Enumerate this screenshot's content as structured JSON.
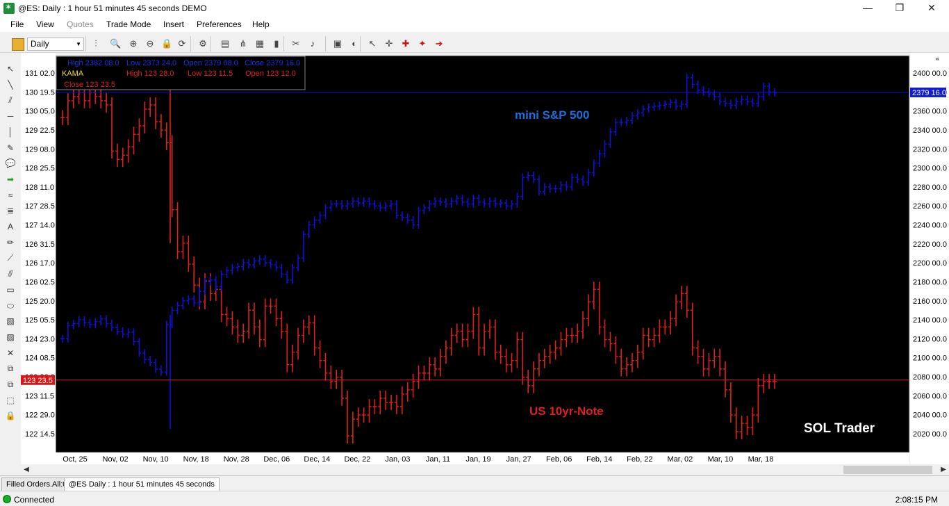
{
  "window": {
    "title": "@ES: Daily : 1 hour 51 minutes 45 seconds DEMO",
    "minimize": "—",
    "restore": "❐",
    "close": "✕"
  },
  "menu": [
    "File",
    "View",
    "Quotes",
    "Trade Mode",
    "Insert",
    "Preferences",
    "Help"
  ],
  "toolbar": {
    "timeframe": "Daily",
    "icons": [
      "bar-style-icon",
      "zoom-icon",
      "zoom-in-icon",
      "zoom-out-icon",
      "lock-icon",
      "refresh-icon",
      "chart-settings-icon",
      "template-icon",
      "hierarchy-icon",
      "indicator-icon",
      "strategy-icon",
      "scissors-icon",
      "alert-bell-icon",
      "paint-icon",
      "eraser-icon",
      "cursor-icon",
      "crosshair-icon",
      "crosshair-red-icon",
      "target-icon",
      "arrow-target-icon"
    ]
  },
  "left_tools": [
    "cursor-icon",
    "line-icon",
    "parallel-lines-icon",
    "horizontal-line-icon",
    "vertical-line-icon",
    "note-icon",
    "callout-icon",
    "arrow-icon",
    "wave-icon",
    "fib-icon",
    "text-tool-icon",
    "pencil-icon",
    "trend-icon",
    "channel-icon",
    "rectangle-icon",
    "ellipse-icon",
    "gallery-icon",
    "image-icon",
    "delete-icon",
    "copy-icon",
    "paste-icon",
    "select-area-icon",
    "lock-icon"
  ],
  "chart_data": {
    "type": "bar",
    "overlay": {
      "line1": {
        "high_label": "High",
        "high": "2382 08.0",
        "low_label": "Low",
        "low": "2373 24.0",
        "open_label": "Open",
        "open": "2379 08.0",
        "close_label": "Close",
        "close": "2379 16.0"
      },
      "line2": {
        "name": "KAMA",
        "high_label": "High",
        "high": "123 28.0",
        "low_label": "Low",
        "low": "123 11.5",
        "open_label": "Open",
        "open": "123 12.0"
      },
      "line3": {
        "close_label": "Close",
        "close": "123 23.5"
      }
    },
    "annotations": {
      "sp_label": "mini S&P 500",
      "note_label": "US 10yr-Note",
      "brand": "SOL Trader"
    },
    "colors": {
      "sp": "#1010d8",
      "note": "#e02020",
      "background": "#000000",
      "frame": "#c8c8c8",
      "sp_marker": "#1020d0",
      "note_marker": "#d81818"
    },
    "x_labels": [
      "Oct, 25",
      "Nov, 02",
      "Nov, 10",
      "Nov, 18",
      "Nov, 28",
      "Dec, 06",
      "Dec, 14",
      "Dec, 22",
      "Jan, 03",
      "Jan, 11",
      "Jan, 19",
      "Jan, 27",
      "Feb, 06",
      "Feb, 14",
      "Feb, 22",
      "Mar, 02",
      "Mar, 10",
      "Mar, 18"
    ],
    "left_axis": {
      "ticks": [
        "131 02.0",
        "130 19.5",
        "130 05.0",
        "129 22.5",
        "129 08.0",
        "128 25.5",
        "128 11.0",
        "127 28.5",
        "127 14.0",
        "126 31.5",
        "126 17.0",
        "126 02.5",
        "125 20.0",
        "125 05.5",
        "124 23.0",
        "124 08.5",
        "123 26.0",
        "123 11.5",
        "122 29.0",
        "122 14.5"
      ],
      "current": "123 23.5",
      "current_value": 123.734
    },
    "right_axis": {
      "ticks": [
        "2400 00.0",
        "2380 00.0",
        "2360 00.0",
        "2340 00.0",
        "2320 00.0",
        "2300 00.0",
        "2280 00.0",
        "2260 00.0",
        "2240 00.0",
        "2220 00.0",
        "2200 00.0",
        "2180 00.0",
        "2160 00.0",
        "2140 00.0",
        "2120 00.0",
        "2100 00.0",
        "2080 00.0",
        "2060 00.0",
        "2040 00.0",
        "2020 00.0"
      ],
      "current": "2379 16.0",
      "current_value": 2379.5,
      "ylim": [
        2020,
        2400
      ]
    },
    "sp_series": {
      "name": "mini S&P 500",
      "closes": [
        2120,
        2134,
        2136,
        2140,
        2137,
        2135,
        2138,
        2141,
        2136,
        2132,
        2128,
        2125,
        2127,
        2117,
        2105,
        2098,
        2095,
        2088,
        2085,
        2135,
        2150,
        2155,
        2160,
        2162,
        2158,
        2170,
        2180,
        2182,
        2175,
        2188,
        2192,
        2195,
        2196,
        2200,
        2198,
        2202,
        2204,
        2200,
        2198,
        2195,
        2188,
        2182,
        2195,
        2205,
        2230,
        2240,
        2245,
        2250,
        2258,
        2262,
        2262,
        2260,
        2262,
        2265,
        2263,
        2265,
        2262,
        2260,
        2258,
        2260,
        2262,
        2250,
        2248,
        2245,
        2240,
        2255,
        2258,
        2262,
        2265,
        2264,
        2262,
        2265,
        2268,
        2264,
        2262,
        2268,
        2264,
        2262,
        2265,
        2262,
        2263,
        2260,
        2262,
        2270,
        2290,
        2292,
        2288,
        2275,
        2280,
        2278,
        2278,
        2282,
        2280,
        2290,
        2288,
        2285,
        2295,
        2305,
        2315,
        2325,
        2338,
        2348,
        2348,
        2350,
        2355,
        2358,
        2362,
        2364,
        2365,
        2366,
        2367,
        2369,
        2365,
        2367,
        2395,
        2388,
        2382,
        2380,
        2378,
        2375,
        2370,
        2368,
        2366,
        2370,
        2372,
        2370,
        2368,
        2375,
        2386,
        2380,
        2379
      ]
    },
    "note_series": {
      "name": "US 10yr-Note",
      "closes": [
        130.0,
        130.4,
        130.5,
        130.6,
        130.4,
        130.6,
        130.5,
        130.4,
        130.3,
        129.2,
        129.0,
        129.1,
        129.3,
        129.6,
        129.8,
        130.2,
        130.3,
        129.9,
        129.7,
        129.4,
        127.8,
        126.8,
        127.0,
        126.5,
        126.0,
        125.6,
        126.1,
        125.8,
        125.9,
        125.3,
        125.2,
        125.0,
        124.8,
        124.9,
        125.4,
        125.0,
        124.7,
        125.5,
        125.5,
        125.2,
        124.9,
        124.1,
        124.4,
        124.8,
        125.0,
        125.1,
        124.5,
        124.2,
        123.9,
        123.7,
        123.8,
        123.3,
        122.4,
        122.8,
        122.9,
        122.9,
        123.1,
        123.1,
        123.3,
        123.2,
        123.2,
        123.1,
        123.4,
        123.5,
        123.7,
        123.9,
        123.9,
        124.1,
        124.0,
        124.3,
        124.5,
        124.8,
        124.9,
        124.7,
        124.9,
        125.3,
        124.5,
        124.9,
        125.0,
        124.4,
        124.3,
        124.1,
        124.2,
        124.7,
        123.8,
        123.6,
        124.0,
        124.2,
        124.3,
        124.4,
        124.5,
        124.7,
        124.8,
        124.8,
        124.9,
        125.2,
        125.6,
        125.9,
        125.0,
        124.7,
        124.6,
        124.3,
        124.0,
        124.1,
        124.2,
        124.4,
        124.8,
        124.7,
        124.8,
        125.0,
        125.0,
        125.2,
        125.6,
        125.8,
        125.4,
        124.5,
        124.3,
        124.0,
        124.2,
        124.3,
        124.0,
        123.5,
        122.9,
        122.5,
        122.7,
        122.6,
        122.9,
        123.6,
        123.7,
        123.7,
        123.7
      ]
    }
  },
  "tabs": [
    "Filled Orders.All:0",
    "@ES Daily : 1 hour 51 minutes 45 seconds"
  ],
  "status": {
    "text": "Connected",
    "time": "2:08:15 PM"
  }
}
